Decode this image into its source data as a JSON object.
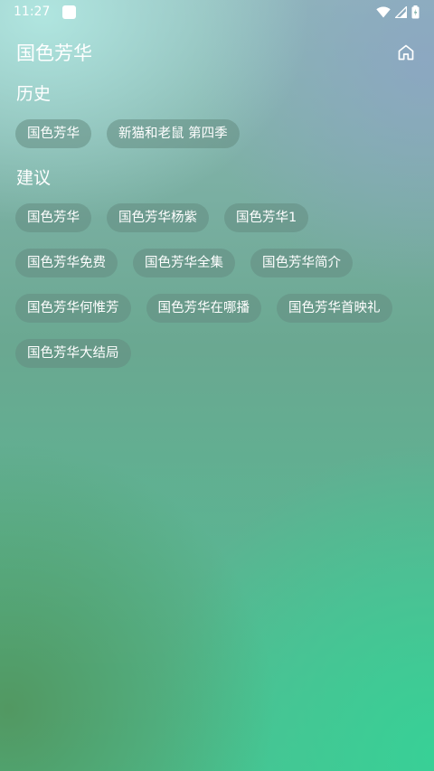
{
  "status_bar": {
    "time": "11:27",
    "icons": [
      "notification-icon",
      "wifi-icon",
      "signal-icon",
      "battery-icon"
    ]
  },
  "header": {
    "title": "国色芳华",
    "home_icon": "home-icon"
  },
  "history": {
    "title": "历史",
    "items": [
      "国色芳华",
      "新猫和老鼠 第四季"
    ]
  },
  "suggestions": {
    "title": "建议",
    "items": [
      "国色芳华",
      "国色芳华杨紫",
      "国色芳华1",
      "国色芳华免费",
      "国色芳华全集",
      "国色芳华简介",
      "国色芳华何惟芳",
      "国色芳华在哪播",
      "国色芳华首映礼",
      "国色芳华大结局"
    ]
  }
}
